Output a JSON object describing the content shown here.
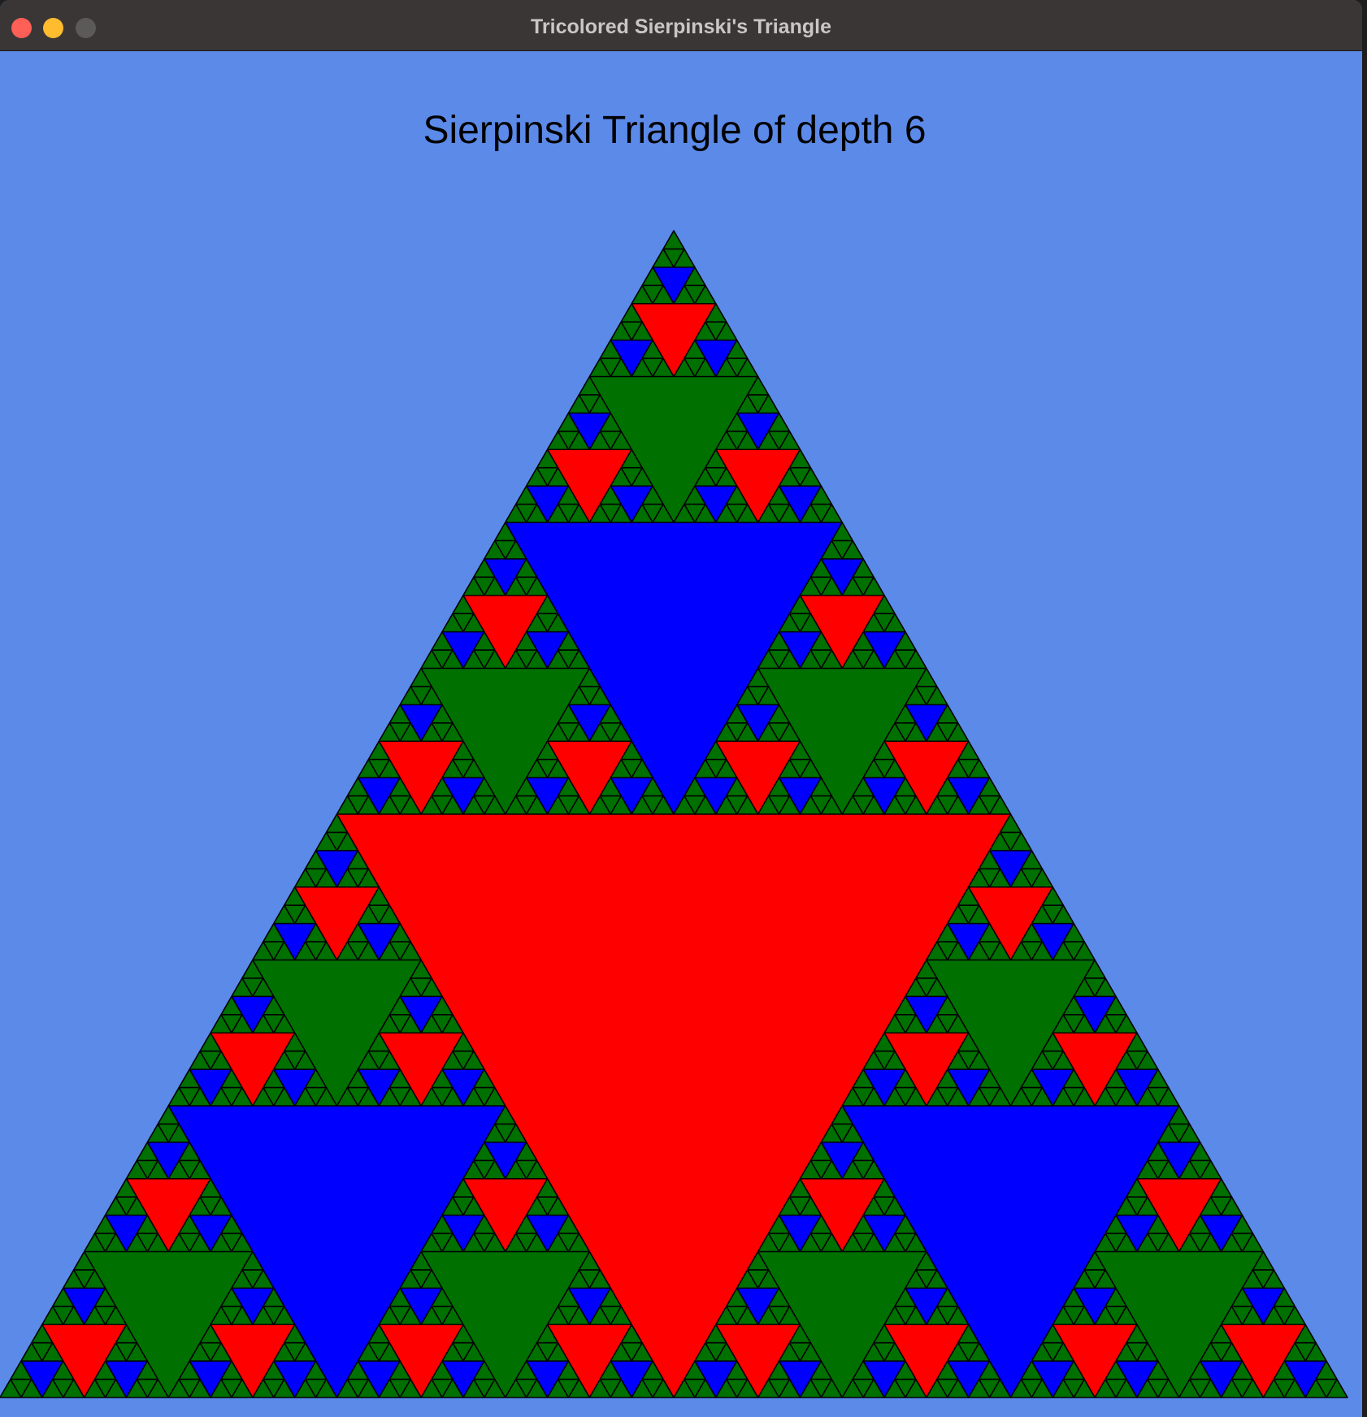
{
  "window": {
    "title": "Tricolored Sierpinski's Triangle"
  },
  "canvas": {
    "heading": "Sierpinski Triangle of depth 6"
  },
  "fractal": {
    "depth": 6,
    "colors": {
      "background": "#5b8ae9",
      "outer": "#007000",
      "level1": "#ff0000",
      "level2": "#0000ff",
      "level3": "#007000",
      "outline": "#000000"
    }
  }
}
